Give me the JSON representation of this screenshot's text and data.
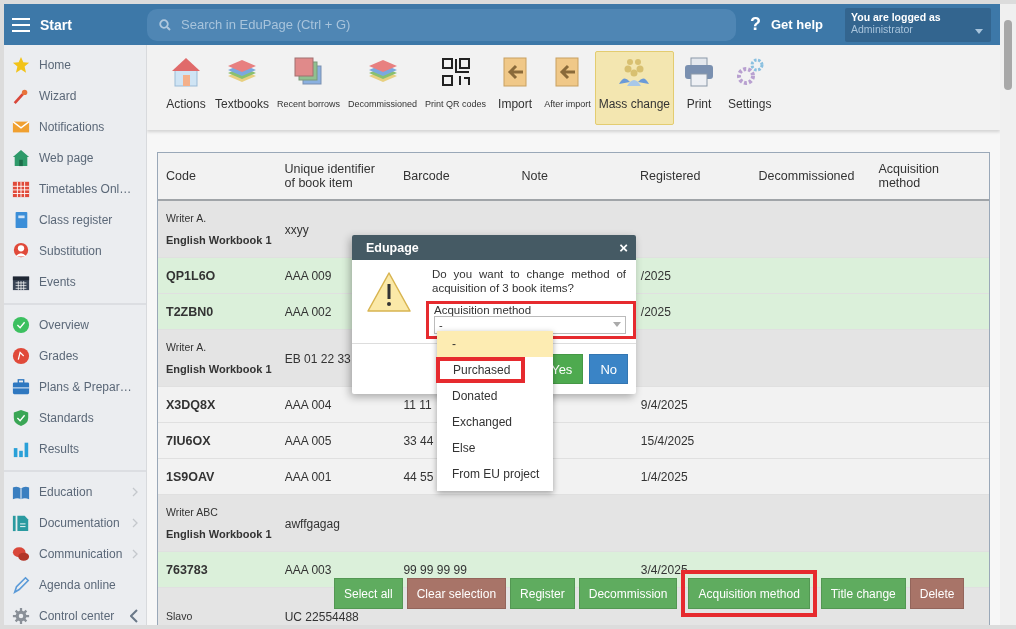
{
  "header": {
    "menu_label": "Start",
    "search": {
      "placeholder": "Search in EduPage (Ctrl + G)"
    },
    "help_icon": "?",
    "help_label": "Get help",
    "login": {
      "caption": "You are logged as",
      "user": "Administrator"
    }
  },
  "sidebar": {
    "sections": [
      {
        "items": [
          {
            "label": "Home"
          },
          {
            "label": "Wizard"
          },
          {
            "label": "Notifications"
          },
          {
            "label": "Web page"
          },
          {
            "label": "Timetables Onl…"
          },
          {
            "label": "Class register"
          },
          {
            "label": "Substitution"
          },
          {
            "label": "Events"
          }
        ]
      },
      {
        "items": [
          {
            "label": "Overview"
          },
          {
            "label": "Grades"
          },
          {
            "label": "Plans & Prepar…"
          },
          {
            "label": "Standards"
          },
          {
            "label": "Results"
          }
        ]
      },
      {
        "items": [
          {
            "label": "Education",
            "kind": "submenu"
          },
          {
            "label": "Documentation",
            "kind": "submenu"
          },
          {
            "label": "Communication",
            "kind": "submenu"
          },
          {
            "label": "Agenda online",
            "kind": "plain"
          },
          {
            "label": "Control center",
            "kind": "collapse"
          }
        ]
      }
    ]
  },
  "toolbar": [
    {
      "label": "Actions",
      "small_label": false,
      "selected": false
    },
    {
      "label": "Textbooks",
      "small_label": false,
      "selected": false
    },
    {
      "label": "Recent borrows",
      "small_label": true,
      "selected": false
    },
    {
      "label": "Decommissioned",
      "small_label": true,
      "selected": false
    },
    {
      "label": "Print QR codes",
      "small_label": true,
      "selected": false
    },
    {
      "label": "Import",
      "small_label": false,
      "selected": false
    },
    {
      "label": "After import",
      "small_label": true,
      "selected": false
    },
    {
      "label": "Mass change",
      "small_label": false,
      "selected": true
    },
    {
      "label": "Print",
      "small_label": false,
      "selected": false
    },
    {
      "label": "Settings",
      "small_label": false,
      "selected": false
    }
  ],
  "table": {
    "columns": [
      "Code",
      "Unique identifier of book item",
      "Barcode",
      "Note",
      "Registered",
      "Decommissioned",
      "Acquisition method"
    ],
    "rows": [
      {
        "kind": "group",
        "author": "Writer A.",
        "title": "English Workbook 1",
        "uid": "xxyy"
      },
      {
        "kind": "item",
        "code": "QP1L6O",
        "uid": "AAA 009",
        "registered": "/2025",
        "selected": true
      },
      {
        "kind": "item",
        "code": "T2ZBN0",
        "uid": "AAA 002",
        "registered": "/2025",
        "selected": true
      },
      {
        "kind": "group",
        "author": "Writer A.",
        "title": "English Workbook 1",
        "uid": "EB 01 22 33"
      },
      {
        "kind": "item",
        "code": "X3DQ8X",
        "uid": "AAA 004",
        "barcode": "11 11",
        "registered": "9/4/2025",
        "selected": false
      },
      {
        "kind": "item",
        "code": "7IU6OX",
        "uid": "AAA 005",
        "barcode": "33 44",
        "registered": "15/4/2025",
        "selected": false
      },
      {
        "kind": "item",
        "code": "1S9OAV",
        "uid": "AAA 001",
        "barcode": "44 55",
        "registered": "1/4/2025",
        "selected": false
      },
      {
        "kind": "group",
        "author": "Writer ABC",
        "title": "English Workbook 1",
        "uid": "awffgagag"
      },
      {
        "kind": "item",
        "code": "763783",
        "uid": "AAA 003",
        "barcode": "99 99 99 99",
        "registered": "3/4/2025",
        "selected": true
      },
      {
        "kind": "group",
        "author": "Slavo",
        "uid": "UC 22554488"
      }
    ]
  },
  "dialog": {
    "title": "Edupage",
    "close": "×",
    "message": "Do you want to change method of acquisition of 3 book items?",
    "field": {
      "label": "Acquisition method",
      "value": "-",
      "highlighted": true
    },
    "options": [
      {
        "label": "-",
        "selected": true,
        "highlighted": false
      },
      {
        "label": "Purchased",
        "selected": false,
        "highlighted": true
      },
      {
        "label": "Donated",
        "selected": false,
        "highlighted": false
      },
      {
        "label": "Exchanged",
        "selected": false,
        "highlighted": false
      },
      {
        "label": "Else",
        "selected": false,
        "highlighted": false
      },
      {
        "label": "From EU project",
        "selected": false,
        "highlighted": false
      }
    ],
    "buttons": [
      {
        "label": "Yes",
        "kind": "confirm"
      },
      {
        "label": "No",
        "kind": "cancel"
      }
    ]
  },
  "action_bar": [
    {
      "label": "Select all",
      "kind": "action",
      "highlighted": false
    },
    {
      "label": "Clear selection",
      "kind": "destructive",
      "highlighted": false
    },
    {
      "label": "Register",
      "kind": "action",
      "highlighted": false
    },
    {
      "label": "Decommission",
      "kind": "action",
      "highlighted": false
    },
    {
      "label": "Acquisition method",
      "kind": "action",
      "highlighted": true
    },
    {
      "label": "Title change",
      "kind": "action",
      "highlighted": false
    },
    {
      "label": "Delete",
      "kind": "destructive",
      "highlighted": false
    }
  ]
}
